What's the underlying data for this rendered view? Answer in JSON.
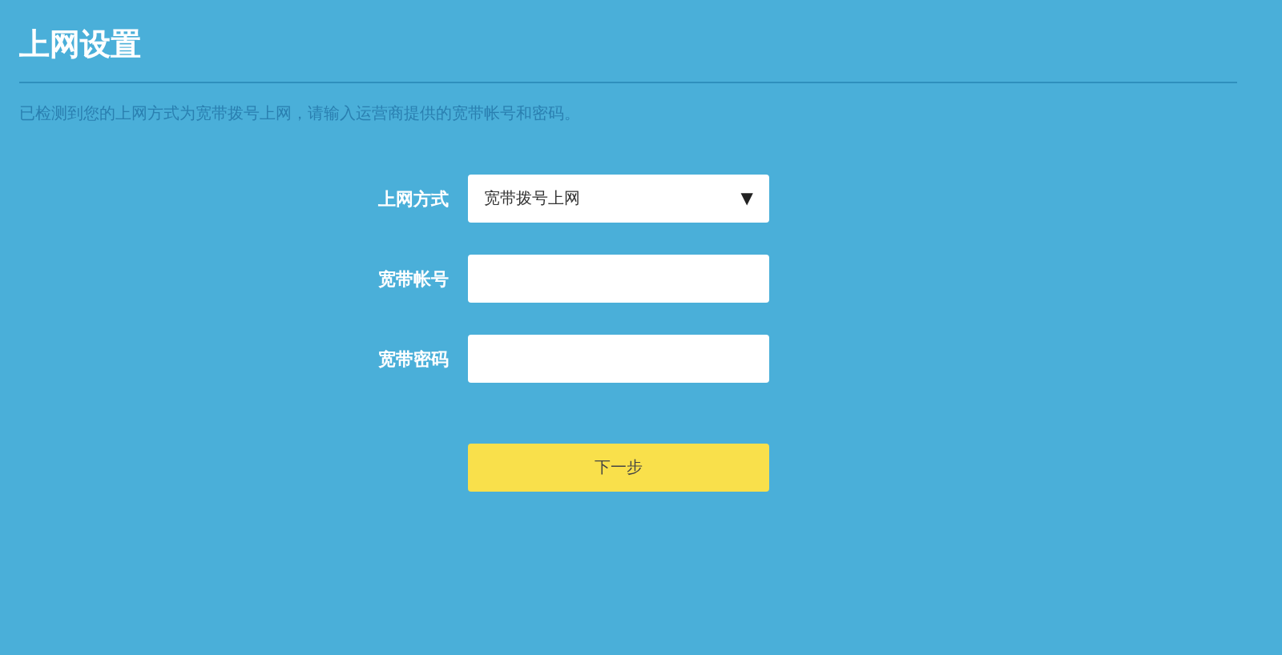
{
  "page": {
    "title": "上网设置",
    "description": "已检测到您的上网方式为宽带拨号上网，请输入运营商提供的宽带帐号和密码。"
  },
  "form": {
    "fields": [
      {
        "label": "上网方式",
        "kind": "select",
        "value": "宽带拨号上网",
        "arrow": "▼"
      },
      {
        "label": "宽带帐号",
        "kind": "text"
      },
      {
        "label": "宽带密码",
        "kind": "password"
      }
    ]
  },
  "next_button": "下一步"
}
